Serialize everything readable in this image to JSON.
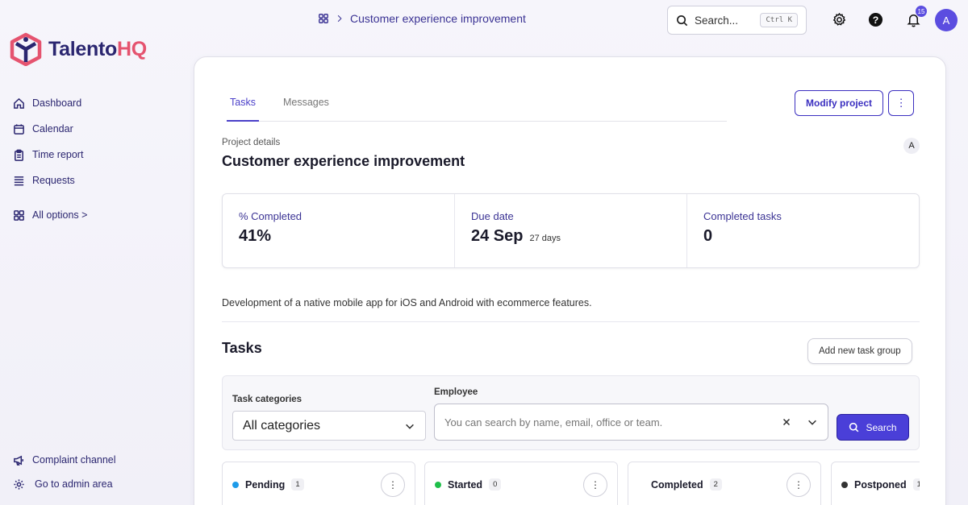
{
  "app": {
    "brand_main": "Talento",
    "brand_accent": "HQ",
    "brand_color": "#2b2670",
    "accent_color": "#e5536f",
    "primary_color": "#4a3fd8"
  },
  "sidebar": {
    "items": [
      {
        "label": "Dashboard",
        "icon": "home-icon"
      },
      {
        "label": "Calendar",
        "icon": "calendar-icon"
      },
      {
        "label": "Time report",
        "icon": "clipboard-icon"
      },
      {
        "label": "Requests",
        "icon": "list-icon"
      }
    ],
    "all_options": "All options >",
    "bottom": [
      {
        "label": "Complaint channel",
        "icon": "megaphone-icon"
      },
      {
        "label": "Go to admin area",
        "icon": "gear-icon"
      }
    ]
  },
  "topbar": {
    "breadcrumb": "Customer experience improvement",
    "search_label": "Search...",
    "search_shortcut": "Ctrl K",
    "notification_count": "15",
    "avatar_initial": "A"
  },
  "project": {
    "tabs": [
      {
        "label": "Tasks",
        "active": true
      },
      {
        "label": "Messages",
        "active": false
      }
    ],
    "modify_button": "Modify project",
    "more_button": "⋮",
    "details_label": "Project details",
    "title": "Customer experience improvement",
    "member_initial": "A",
    "stats": {
      "completed_label": "% Completed",
      "completed_value": "41%",
      "due_label": "Due date",
      "due_value": "24 Sep",
      "due_remaining": "27 days",
      "tasks_label": "Completed tasks",
      "tasks_value": "0"
    },
    "description": "Development of a native mobile app for iOS and Android with ecommerce features."
  },
  "tasks": {
    "heading": "Tasks",
    "add_group_button": "Add new task group",
    "filters": {
      "category_label": "Task categories",
      "category_value": "All categories",
      "employee_label": "Employee",
      "employee_placeholder": "You can search by name, email, office or team.",
      "search_button": "Search"
    },
    "columns": [
      {
        "label": "Pending",
        "count": "1",
        "color": "#1e9be9"
      },
      {
        "label": "Started",
        "count": "0",
        "color": "#1fbf4a"
      },
      {
        "label": "Completed",
        "count": "2",
        "color": "#ffffff"
      },
      {
        "label": "Postponed",
        "count": "1",
        "color": "#333333"
      }
    ]
  }
}
